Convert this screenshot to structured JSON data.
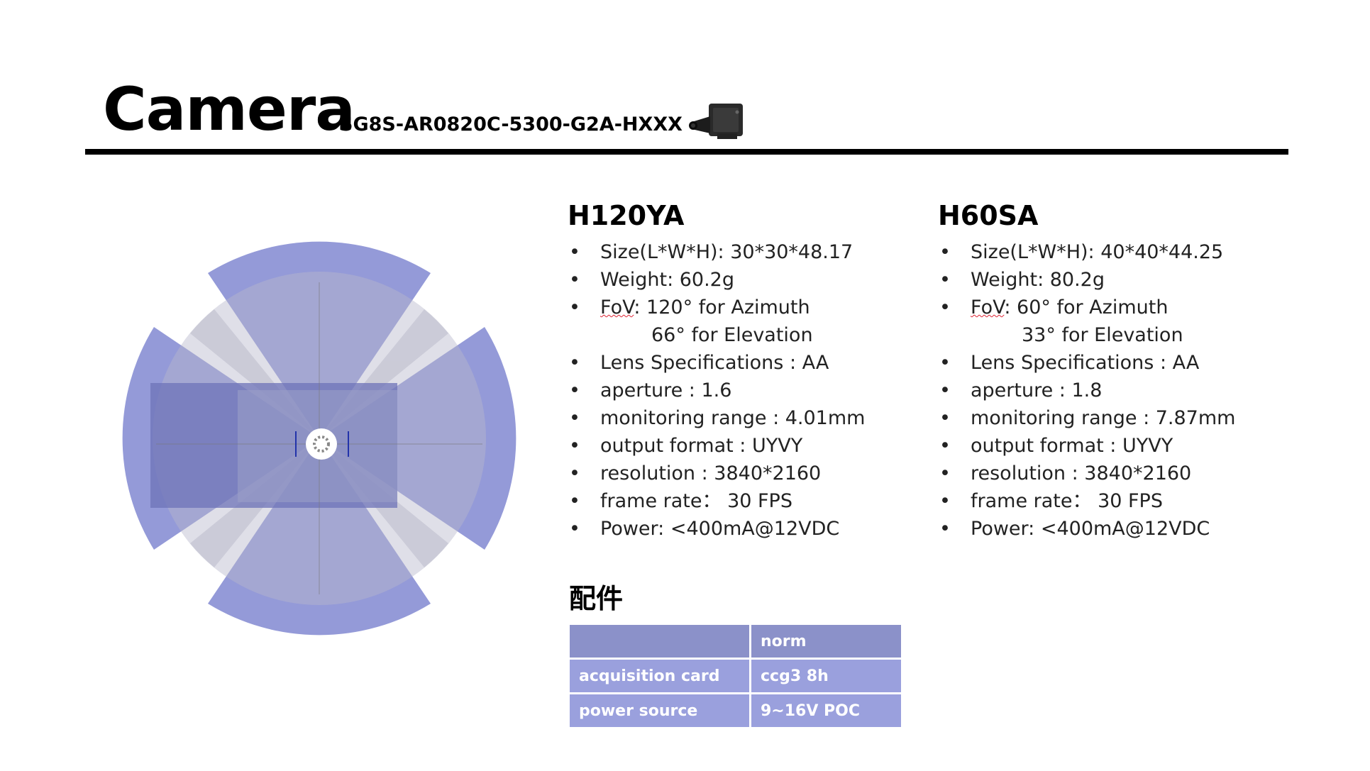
{
  "header": {
    "title": "Camera",
    "model": "SG8S-AR0820C-5300-G2A-HXXX",
    "product_icon": "camera-module-photo"
  },
  "colors": {
    "fov_wide": "#8b91d6",
    "fov_narrow": "#c8c8d2",
    "table_header": "#8b91c9",
    "table_row": "#9aa0dd"
  },
  "specs": [
    {
      "name": "H120YA",
      "size": "Size(L*W*H): 30*30*48.17",
      "weight": "Weight: 60.2g",
      "fov_label": "FoV",
      "fov_az": ": 120° for Azimuth",
      "fov_el": "66° for Elevation",
      "lens": "Lens Specifications : AA",
      "aperture": "aperture : 1.6",
      "range": "monitoring range : 4.01mm",
      "output": "output format : UYVY",
      "resolution": "resolution : 3840*2160",
      "frame_rate": "frame rate： 30 FPS",
      "power": "Power: <400mA@12VDC"
    },
    {
      "name": "H60SA",
      "size": "Size(L*W*H): 40*40*44.25",
      "weight": "Weight: 80.2g",
      "fov_label": "FoV",
      "fov_az": ": 60° for Azimuth",
      "fov_el": "33° for Elevation",
      "lens": "Lens Specifications : AA",
      "aperture": "aperture : 1.8",
      "range": "monitoring range : 7.87mm",
      "output": "output format : UYVY",
      "resolution": "resolution : 3840*2160",
      "frame_rate": "frame rate： 30 FPS",
      "power": "Power: <400mA@12VDC"
    }
  ],
  "accessories": {
    "title": "配件",
    "header": [
      "",
      "norm"
    ],
    "rows": [
      [
        "acquisition card",
        "ccg3 8h"
      ],
      [
        "power source",
        "9~16V POC"
      ]
    ]
  }
}
